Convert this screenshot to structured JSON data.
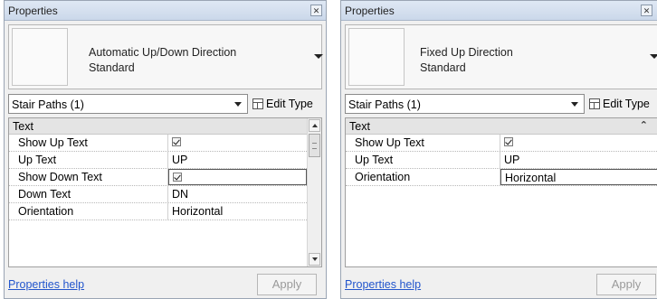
{
  "left_panel": {
    "title": "Properties",
    "type_line1": "Automatic Up/Down Direction",
    "type_line2": "Standard",
    "filter": "Stair Paths (1)",
    "edit_type_label": "Edit Type",
    "group_label": "Text",
    "rows": [
      {
        "name": "Show Up Text",
        "value": "",
        "checkbox": true
      },
      {
        "name": "Up Text",
        "value": "UP",
        "checkbox": false
      },
      {
        "name": "Show Down Text",
        "value": "",
        "checkbox": true
      },
      {
        "name": "Down Text",
        "value": "DN",
        "checkbox": false
      },
      {
        "name": "Orientation",
        "value": "Horizontal",
        "checkbox": false
      }
    ],
    "help_link": "Properties help",
    "apply_label": "Apply"
  },
  "right_panel": {
    "title": "Properties",
    "type_line1": "Fixed Up Direction",
    "type_line2": "Standard",
    "filter": "Stair Paths (1)",
    "edit_type_label": "Edit Type",
    "group_label": "Text",
    "rows": [
      {
        "name": "Show Up Text",
        "value": "",
        "checkbox": true
      },
      {
        "name": "Up Text",
        "value": "UP",
        "checkbox": false
      },
      {
        "name": "Orientation",
        "value": "Horizontal",
        "checkbox": false
      }
    ],
    "help_link": "Properties help",
    "apply_label": "Apply"
  },
  "icons": {
    "close": "close-icon",
    "dropdown": "chevron-down-icon",
    "edit_type": "edit-type-icon",
    "collapse": "collapse-icon",
    "checkbox": "checkbox-icon"
  },
  "colors": {
    "link": "#2255cc",
    "titlebar": "#cbd8ea",
    "apply_disabled_text": "#9a9a9a"
  }
}
